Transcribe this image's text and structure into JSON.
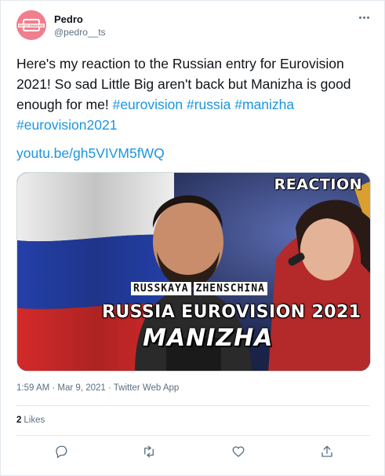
{
  "author": {
    "name": "Pedro",
    "handle": "@pedro__ts",
    "avatar_text": "FIFTY SHADES",
    "avatar_color": "#ef7f8e"
  },
  "tweet": {
    "text": "Here's my reaction to the Russian entry for Eurovision 2021! So sad Little Big aren't back but Manizha is good enough for me!",
    "hashtags": [
      "#eurovision",
      "#russia",
      "#manizha",
      "#eurovision2021"
    ],
    "link": "youtu.be/gh5VIVM5fWQ",
    "link_color": "#1b95e0"
  },
  "thumbnail": {
    "corner_label": "REACTION",
    "song_words": [
      "RUSSKAYA",
      "ZHENSCHINA"
    ],
    "line1": "RUSSIA EUROVISION 2021",
    "line2": "MANIZHA"
  },
  "meta": {
    "timestamp": "1:59 AM · Mar 9, 2021 · Twitter Web App"
  },
  "stats": {
    "likes_count": "2",
    "likes_label": "Likes"
  },
  "actions": {
    "reply_icon": "reply-icon",
    "retweet_icon": "retweet-icon",
    "like_icon": "like-icon",
    "share_icon": "share-icon",
    "icon_color": "#5b7083"
  }
}
